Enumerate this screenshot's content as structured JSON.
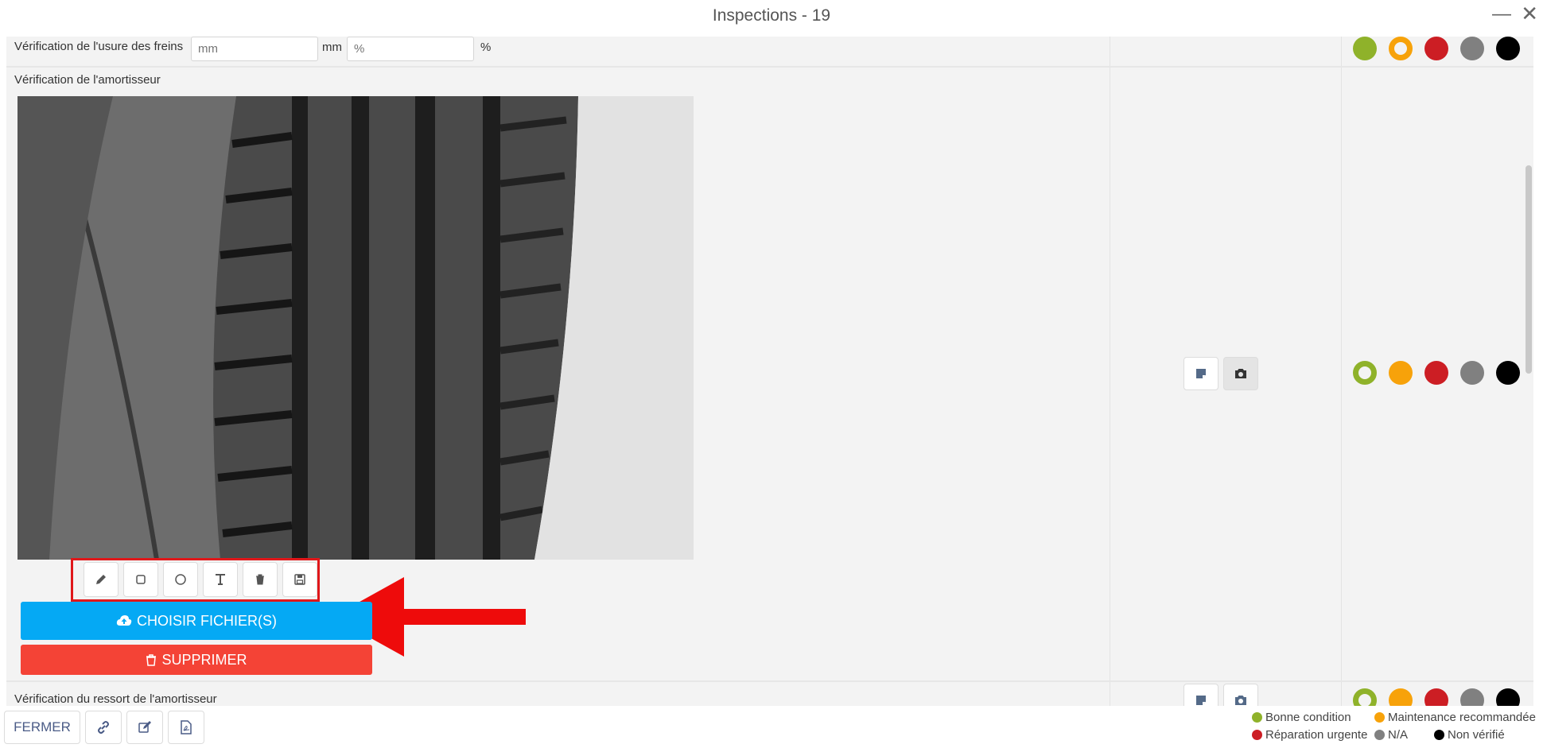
{
  "window": {
    "title": "Inspections - 19",
    "minimize_glyph": "—",
    "close_glyph": "✕"
  },
  "rows": {
    "brake": {
      "label": "Vérification de l'usure des freins",
      "mm_placeholder": "mm",
      "mm_unit": "mm",
      "pct_placeholder": "%",
      "pct_unit": "%"
    },
    "shock": {
      "label": "Vérification de l'amortisseur",
      "choose_label": "CHOISIR FICHIER(S)",
      "delete_label": "SUPPRIMER"
    },
    "spring": {
      "label": "Vérification du ressort de l'amortisseur"
    }
  },
  "annotation_tools": [
    "pencil-icon",
    "square-icon",
    "circle-icon",
    "text-icon",
    "trash-icon",
    "save-icon"
  ],
  "status_colors": {
    "good": "#8fb22a",
    "maintenance": "#f7a20a",
    "urgent": "#cc1e24",
    "na": "#808080",
    "unchecked": "#000000"
  },
  "footer": {
    "close_label": "FERMER"
  },
  "legend": {
    "good": "Bonne condition",
    "maintenance": "Maintenance recommandée",
    "urgent": "Réparation urgente",
    "na": "N/A",
    "unchecked": "Non vérifié"
  }
}
